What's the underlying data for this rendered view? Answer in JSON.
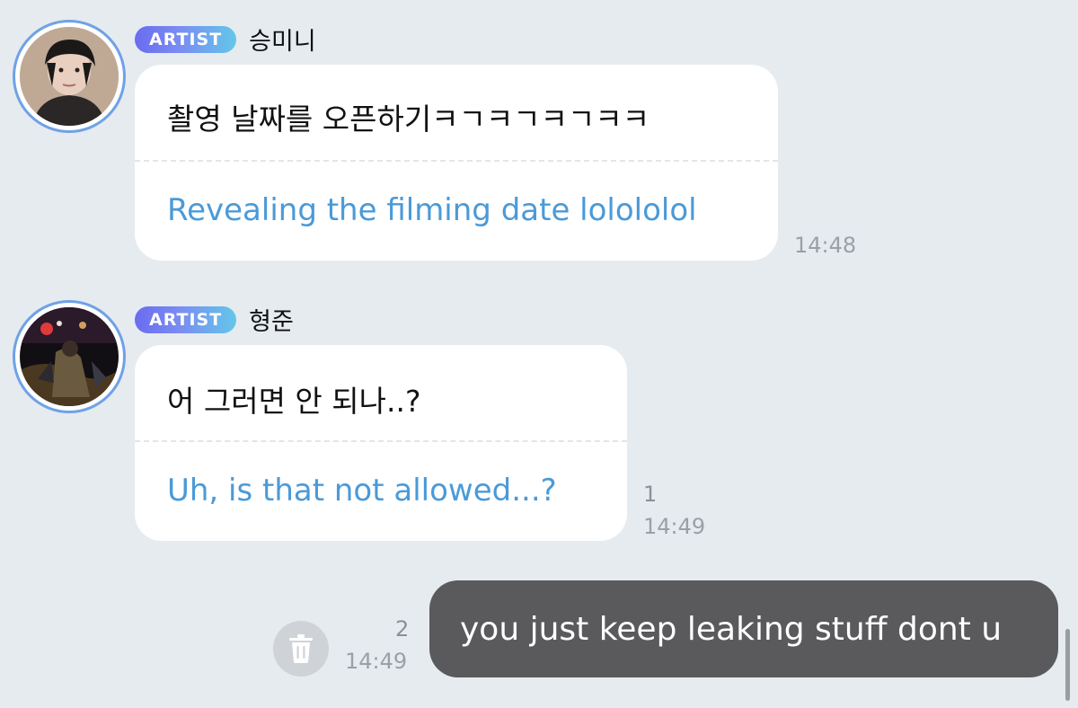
{
  "messages": [
    {
      "badge": "ARTIST",
      "sender": "승미니",
      "original": "촬영 날짜를 오픈하기ㅋㄱㅋㄱㅋㄱㅋㅋ",
      "translation": "Revealing the filming date lolololol",
      "time": "14:48"
    },
    {
      "badge": "ARTIST",
      "sender": "형준",
      "original": "어 그러면 안 되나..?",
      "translation": "Uh, is that not allowed...?",
      "unread_count": "1",
      "time": "14:49"
    }
  ],
  "my_message": {
    "text": "you just keep leaking stuff dont u",
    "unread_count": "2",
    "time": "14:49"
  },
  "icons": {
    "delete": "trash-icon"
  },
  "colors": {
    "background": "#e6ebf0",
    "translation_text": "#4a9ad8",
    "my_bubble": "#5a5a5c",
    "badge_start": "#6a6cf0",
    "badge_end": "#63c7e8",
    "avatar_ring": "#6fa2e6"
  }
}
